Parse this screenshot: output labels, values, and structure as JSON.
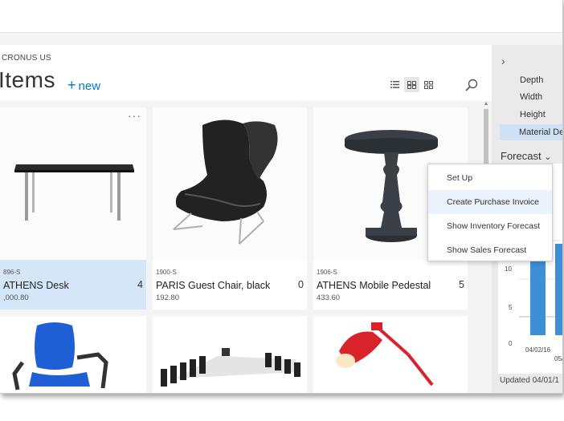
{
  "header": {
    "company": "CRONUS US",
    "title": "Items",
    "new_label": "new"
  },
  "items": [
    {
      "code": "896-S",
      "name": "ATHENS Desk",
      "price": ",000.80",
      "qty": "4",
      "selected": true
    },
    {
      "code": "1900-S",
      "name": "PARIS Guest Chair, black",
      "price": "192.80",
      "qty": "0",
      "selected": false
    },
    {
      "code": "1906-S",
      "name": "ATHENS Mobile Pedestal",
      "price": "433.60",
      "qty": "5",
      "selected": false
    }
  ],
  "tile_more": "···",
  "details": {
    "fields": [
      "Depth",
      "Width",
      "Height",
      "Material Des"
    ],
    "forecast_label": "Forecast",
    "chart_data": {
      "type": "bar",
      "yticks": [
        "10",
        "5",
        "0"
      ],
      "xticks": [
        "04/02/16",
        "05/"
      ]
    },
    "updated": "Updated 04/01/1"
  },
  "context_menu": {
    "items": [
      "Set Up",
      "Create Purchase Invoice",
      "Show Inventory Forecast",
      "Show Sales Forecast"
    ]
  },
  "colors": {
    "accent": "#0078d4",
    "selected_tile": "#d4e6f8",
    "chart_bar": "#3e8fd8"
  }
}
